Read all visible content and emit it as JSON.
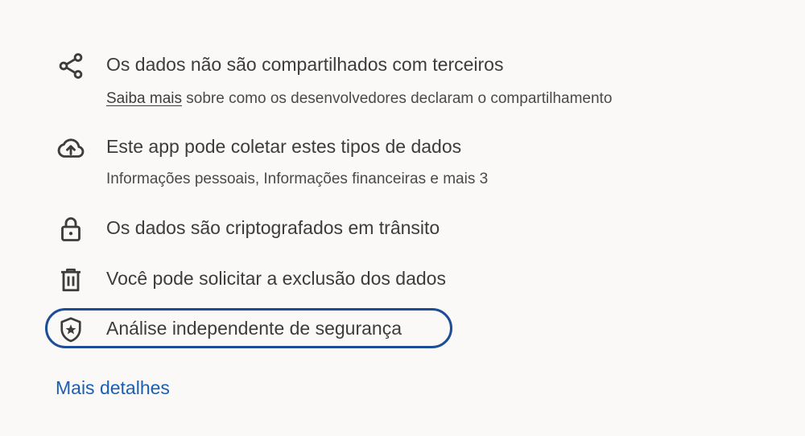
{
  "items": [
    {
      "icon": "share-icon",
      "title": "Os dados não são compartilhados com terceiros",
      "link_text": "Saiba mais",
      "subtitle_rest": " sobre como os desenvolvedores declaram o compartilhamento"
    },
    {
      "icon": "cloud-upload-icon",
      "title": "Este app pode coletar estes tipos de dados",
      "subtitle": "Informações pessoais, Informações financeiras e mais 3"
    },
    {
      "icon": "lock-icon",
      "title": "Os dados são criptografados em trânsito"
    },
    {
      "icon": "trash-icon",
      "title": "Você pode solicitar a exclusão dos dados"
    },
    {
      "icon": "shield-star-icon",
      "title": "Análise independente de segurança"
    }
  ],
  "more_details_label": "Mais detalhes",
  "colors": {
    "background": "#faf9f8",
    "text": "#3c3c3c",
    "link": "#1a5fb4",
    "highlight_border": "#1d4e94"
  }
}
